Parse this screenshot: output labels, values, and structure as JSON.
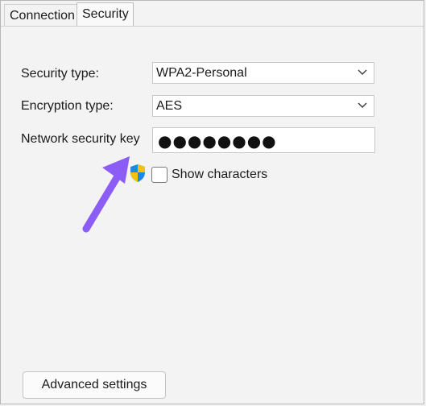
{
  "tabs": [
    {
      "label": "Connection"
    },
    {
      "label": "Security"
    }
  ],
  "form": {
    "security_type": {
      "label": "Security type:",
      "value": "WPA2-Personal"
    },
    "encryption_type": {
      "label": "Encryption type:",
      "value": "AES"
    },
    "network_key": {
      "label": "Network security key",
      "masked_value": "●●●●●●●●"
    },
    "show_characters": {
      "label": "Show characters",
      "checked": false
    }
  },
  "buttons": {
    "advanced_settings": "Advanced settings"
  },
  "icons": {
    "chevron": "chevron-down-icon",
    "shield": "uac-shield-icon",
    "annotation_arrow": "annotation-arrow-icon"
  },
  "colors": {
    "annotation_arrow": "#8b5cf6",
    "shield_blue": "#1e88e5",
    "shield_yellow": "#f4c20d"
  }
}
